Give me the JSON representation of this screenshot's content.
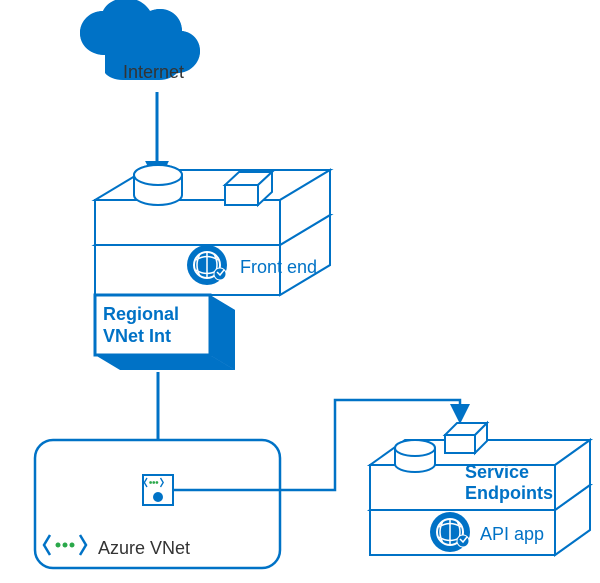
{
  "labels": {
    "internet": "Internet",
    "front_end": "Front end",
    "regional_vnet_int_line1": "Regional",
    "regional_vnet_int_line2": "VNet Int",
    "azure_vnet": "Azure VNet",
    "service_endpoints_line1": "Service",
    "service_endpoints_line2": "Endpoints",
    "api_app": "API app"
  },
  "colors": {
    "azure_blue": "#0072c6",
    "white": "#ffffff",
    "text": "#333333"
  },
  "nodes": [
    {
      "id": "internet",
      "type": "cloud",
      "role": "source"
    },
    {
      "id": "front_end",
      "type": "app_service",
      "role": "web_front_end"
    },
    {
      "id": "regional_vnet_int",
      "type": "vnet_integration",
      "role": "outbound_vnet_integration"
    },
    {
      "id": "azure_vnet",
      "type": "virtual_network",
      "role": "network"
    },
    {
      "id": "service_endpoints",
      "type": "service_endpoint",
      "role": "backend_access"
    },
    {
      "id": "api_app",
      "type": "app_service",
      "role": "api_backend"
    }
  ],
  "flows": [
    {
      "from": "internet",
      "to": "front_end"
    },
    {
      "from": "front_end",
      "to": "regional_vnet_int"
    },
    {
      "from": "regional_vnet_int",
      "to": "azure_vnet"
    },
    {
      "from": "azure_vnet",
      "to": "service_endpoints"
    },
    {
      "from": "service_endpoints",
      "to": "api_app"
    }
  ]
}
